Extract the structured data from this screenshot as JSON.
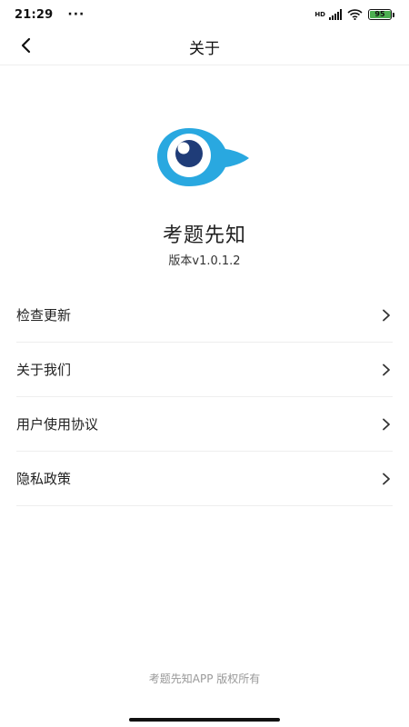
{
  "status_bar": {
    "time": "21:29",
    "dots": "···",
    "network_label": "HD",
    "battery_level": "95",
    "battery_fraction": 0.95,
    "battery_color": "#4caf50",
    "icons": [
      "signal-icon",
      "wifi-icon",
      "battery-icon"
    ]
  },
  "nav": {
    "title": "关于",
    "back_icon": "chevron-left-icon"
  },
  "app": {
    "name": "考题先知",
    "version": "版本v1.0.1.2",
    "logo_icon": "eye-logo-icon",
    "logo_color": "#29a8e0",
    "pupil_color": "#1f3c78"
  },
  "menu": {
    "items": [
      {
        "label": "检查更新"
      },
      {
        "label": "关于我们"
      },
      {
        "label": "用户使用协议"
      },
      {
        "label": "隐私政策"
      }
    ],
    "chevron_icon": "chevron-right-icon"
  },
  "footer": {
    "copyright": "考题先知APP 版权所有"
  }
}
